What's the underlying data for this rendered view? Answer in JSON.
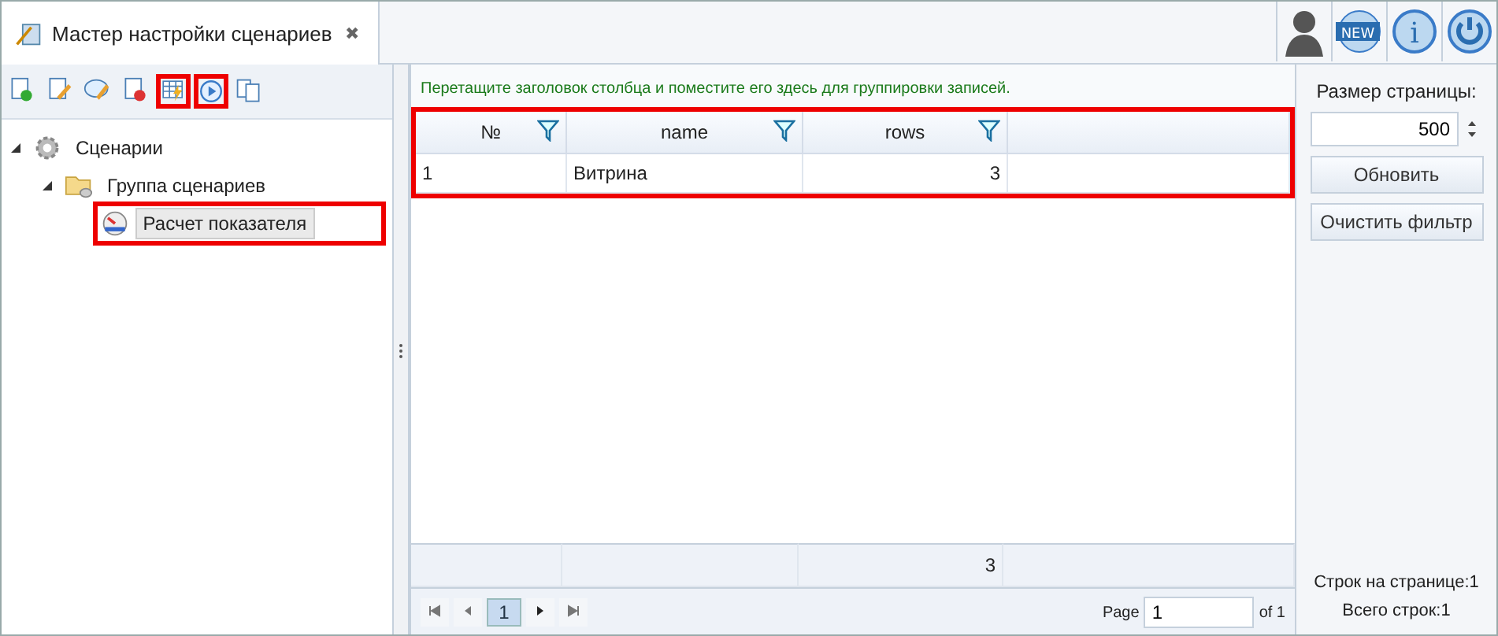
{
  "tab": {
    "title": "Мастер настройки сценариев",
    "close": "✖",
    "selected": true
  },
  "header_icons": [
    {
      "kind": "user"
    },
    {
      "kind": "new",
      "label": "NEW"
    },
    {
      "kind": "info",
      "label": "i"
    },
    {
      "kind": "power"
    }
  ],
  "toolbar": [
    {
      "kind": "add",
      "highlighted": false
    },
    {
      "kind": "edit",
      "highlighted": false
    },
    {
      "kind": "comment",
      "highlighted": false
    },
    {
      "kind": "delete",
      "highlighted": false
    },
    {
      "kind": "table",
      "highlighted": true
    },
    {
      "kind": "play",
      "highlighted": true
    },
    {
      "kind": "copy",
      "highlighted": false
    }
  ],
  "tree": [
    {
      "label": "Сценарии",
      "kind": "gear",
      "expanded": true,
      "selected": false,
      "highlighted": false,
      "children": [
        {
          "label": "Группа сценариев",
          "kind": "folder",
          "expanded": true,
          "selected": false,
          "highlighted": false,
          "children": [
            {
              "label": "Расчет показателя",
              "kind": "gauge",
              "selected": true,
              "highlighted": true
            }
          ]
        }
      ]
    }
  ],
  "grid": {
    "group_hint": "Перетащите заголовок столбца и поместите его здесь для группировки записей.",
    "highlighted": true,
    "columns": [
      {
        "label": "№",
        "filter": true
      },
      {
        "label": "name",
        "filter": true
      },
      {
        "label": "rows",
        "filter": true
      }
    ],
    "rows": [
      [
        "1",
        "Витрина",
        "3"
      ]
    ],
    "footer_total": "3",
    "pager": {
      "current": "1",
      "page_label": "Page",
      "page_value": "1",
      "of_label": "of 1"
    }
  },
  "side": {
    "page_size_label": "Размер страницы:",
    "page_size": "500",
    "buttons": [
      "Обновить",
      "Очистить фильтр"
    ],
    "rows_on_page": "Строк на странице:1",
    "total_rows": "Всего строк:1"
  }
}
